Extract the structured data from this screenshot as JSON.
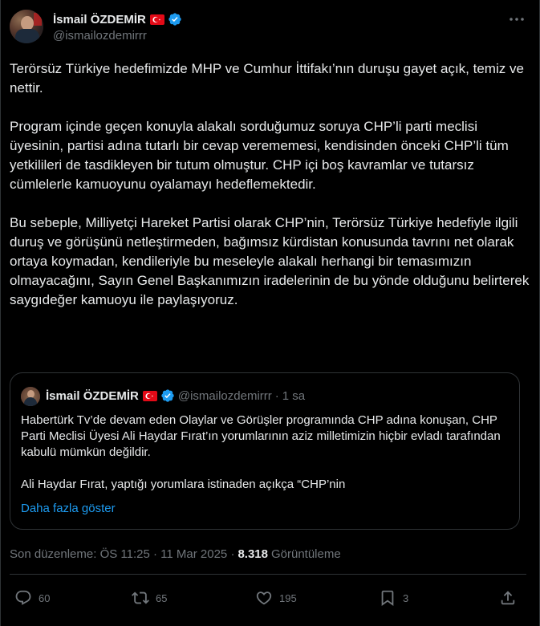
{
  "author": {
    "name": "İsmail ÖZDEMİR",
    "handle": "@ismailozdemirrr"
  },
  "more_icon": "more-horizontal-icon",
  "post": {
    "paragraphs": [
      "Terörsüz Türkiye hedefimizde MHP ve Cumhur İttifakı’nın duruşu gayet açık, temiz ve nettir.",
      "Program içinde geçen konuyla alakalı sorduğumuz soruya CHP’li parti meclisi üyesinin, partisi adına tutarlı bir cevap verememesi, kendisinden önceki CHP’li tüm yetkilileri de tasdikleyen bir tutum olmuştur. CHP içi boş kavramlar ve tutarsız cümlelerle kamuoyunu oyalamayı hedeflemektedir.",
      "Bu sebeple, Milliyetçi Hareket Partisi olarak CHP’nin, Terörsüz Türkiye hedefiyle ilgili duruş ve görüşünü netleştirmeden, bağımsız kürdistan konusunda tavrını net olarak ortaya koymadan, kendileriyle bu meseleyle alakalı herhangi bir temasımızın olmayacağını, Sayın Genel Başkanımızın iradelerinin de bu yönde olduğunu belirterek saygıdeğer kamuoyu ile paylaşıyoruz."
    ]
  },
  "quote": {
    "name": "İsmail ÖZDEMİR",
    "handle": "@ismailozdemirrr",
    "dot": "·",
    "time": "1 sa",
    "paragraphs": [
      "Habertürk Tv’de devam eden Olaylar ve Görüşler programında CHP adına konuşan, CHP Parti Meclisi Üyesi Ali Haydar Fırat’ın yorumlarının aziz milletimizin hiçbir evladı tarafından kabulü mümkün değildir.",
      "Ali Haydar Fırat, yaptığı yorumlara istinaden açıkça “CHP’nin"
    ],
    "show_more": "Daha fazla göster"
  },
  "meta": {
    "edited": "Son düzenleme: ÖS 11:25 · 11 Mar 2025 ·",
    "views": "8.318",
    "views_label": "Görüntüleme"
  },
  "actions": {
    "replies": "60",
    "reposts": "65",
    "likes": "195",
    "bookmarks": "3"
  },
  "colors": {
    "background": "#000000",
    "text": "#e7e9ea",
    "muted": "#71767b",
    "accent": "#1d9bf0",
    "flag": "#e30a17"
  }
}
